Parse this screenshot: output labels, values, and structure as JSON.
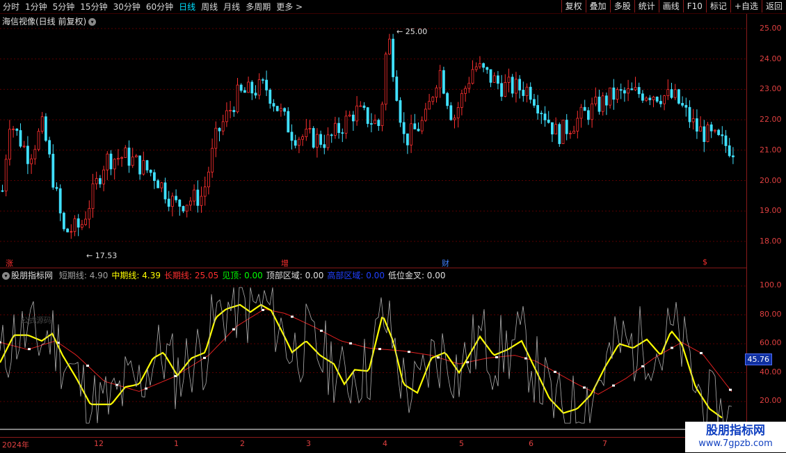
{
  "toolbar": {
    "periods": [
      "分时",
      "1分钟",
      "5分钟",
      "15分钟",
      "30分钟",
      "60分钟",
      "日线",
      "周线",
      "月线",
      "多周期",
      "更多 >"
    ],
    "active_period": "日线",
    "right_buttons": [
      "复权",
      "叠加",
      "多股",
      "统计",
      "画线",
      "F10",
      "标记",
      "+自选",
      "返回"
    ]
  },
  "main": {
    "title": "海信视像(日线 前复权)",
    "high_label": "25.00",
    "low_label": "17.53"
  },
  "price_axis": [
    "25.00",
    "24.00",
    "23.00",
    "22.00",
    "21.00",
    "20.00",
    "19.00",
    "18.00"
  ],
  "indicator_axis": [
    "100.0",
    "80.00",
    "60.00",
    "40.00",
    "20.00"
  ],
  "indicator": {
    "name": "股朋指标网",
    "items": [
      {
        "text": "短期线: 4.90",
        "color": "#a0a0a0"
      },
      {
        "text": "中期线: 4.39",
        "color": "#ffff00"
      },
      {
        "text": "长期线: 25.05",
        "color": "#ff3030"
      },
      {
        "text": "见顶: 0.00",
        "color": "#00ff00"
      },
      {
        "text": "顶部区域: 0.00",
        "color": "#e0e0e0"
      },
      {
        "text": "高部区域: 0.00",
        "color": "#2040ff"
      },
      {
        "text": "低位金叉: 0.00",
        "color": "#e0e0e0"
      }
    ],
    "current_value": "45.76",
    "faint_text": "公式源码"
  },
  "markers": [
    {
      "text": "涨",
      "color": "#ff3030"
    },
    {
      "text": "增",
      "color": "#ff3030"
    },
    {
      "text": "财",
      "color": "#4080ff"
    },
    {
      "text": "$",
      "color": "#ff3030"
    }
  ],
  "dates": [
    "2024年",
    "12",
    "1",
    "2",
    "3",
    "4",
    "5",
    "6",
    "7"
  ],
  "watermark": {
    "line1": "股朋指标网",
    "line2": "www.7gpzb.com"
  }
}
